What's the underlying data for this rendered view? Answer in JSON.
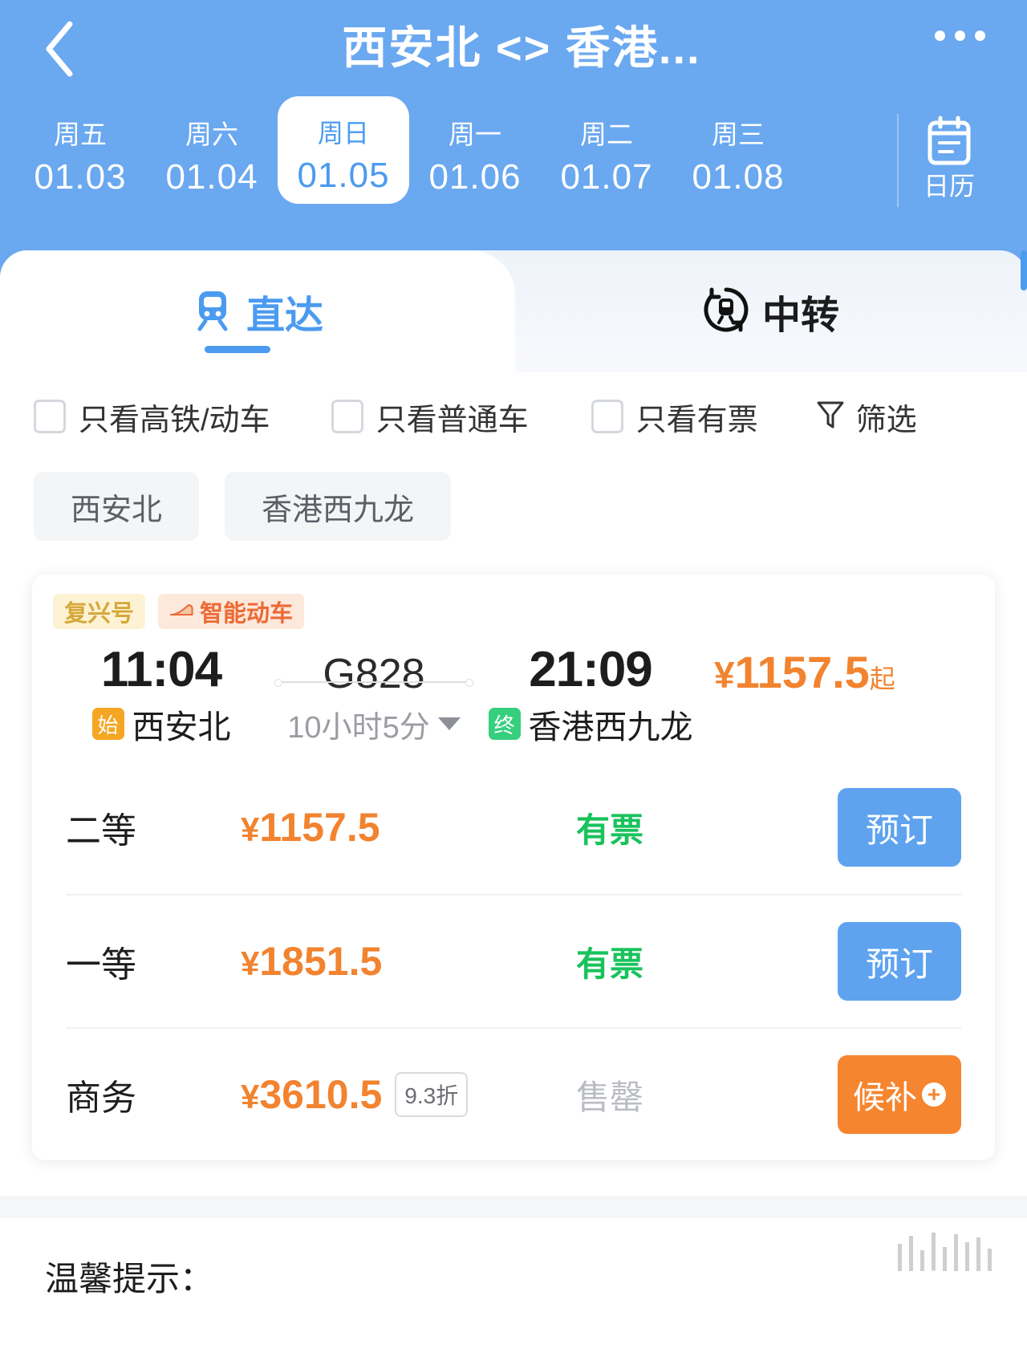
{
  "header": {
    "back_icon": "chevron-left-icon",
    "title": "西安北 <> 香港...",
    "more_icon": "more-options-icon",
    "dates": [
      {
        "dow": "周五",
        "date": "01.03",
        "active": false
      },
      {
        "dow": "周六",
        "date": "01.04",
        "active": false
      },
      {
        "dow": "周日",
        "date": "01.05",
        "active": true
      },
      {
        "dow": "周一",
        "date": "01.06",
        "active": false
      },
      {
        "dow": "周二",
        "date": "01.07",
        "active": false
      },
      {
        "dow": "周三",
        "date": "01.08",
        "active": false
      }
    ],
    "calendar": {
      "icon": "calendar-icon",
      "label": "日历"
    }
  },
  "tabs": {
    "direct": {
      "label": "直达",
      "icon": "train-front-icon",
      "active": true
    },
    "transfer": {
      "label": "中转",
      "icon": "train-transfer-icon",
      "active": false
    }
  },
  "filters": {
    "checkboxes": [
      {
        "label": "只看高铁/动车",
        "checked": false
      },
      {
        "label": "只看普通车",
        "checked": false
      },
      {
        "label": "只看有票",
        "checked": false
      }
    ],
    "filter_button": {
      "label": "筛选",
      "icon": "funnel-icon"
    }
  },
  "station_chips": [
    {
      "label": "西安北"
    },
    {
      "label": "香港西九龙"
    }
  ],
  "train": {
    "badges": [
      {
        "label": "复兴号",
        "icon": null
      },
      {
        "label": "智能动车",
        "icon": "bullet-train-icon"
      }
    ],
    "depart_time": "11:04",
    "train_no": "G828",
    "arrive_time": "21:09",
    "price_from": {
      "currency": "¥",
      "amount": "1157.5",
      "suffix": "起"
    },
    "depart_station": {
      "tag": "始",
      "name": "西安北"
    },
    "arrive_station": {
      "tag": "终",
      "name": "香港西九龙"
    },
    "duration": "10小时5分",
    "duration_caret": "chevron-down-icon",
    "seats": [
      {
        "name": "二等",
        "currency": "¥",
        "price": "1157.5",
        "discount": null,
        "status": "有票",
        "status_kind": "available",
        "action": {
          "label": "预订",
          "kind": "book"
        }
      },
      {
        "name": "一等",
        "currency": "¥",
        "price": "1851.5",
        "discount": null,
        "status": "有票",
        "status_kind": "available",
        "action": {
          "label": "预订",
          "kind": "book"
        }
      },
      {
        "name": "商务",
        "currency": "¥",
        "price": "3610.5",
        "discount": "9.3折",
        "status": "售罄",
        "status_kind": "soldout",
        "action": {
          "label": "候补",
          "kind": "waitlist",
          "plus": "+"
        }
      }
    ]
  },
  "tips": {
    "title": "温馨提示："
  },
  "colors": {
    "brand_blue": "#6aa8f0",
    "accent_blue": "#4b9bf0",
    "price_orange": "#f2832f",
    "available_green": "#19c25c",
    "soldout_gray": "#b9bcc1",
    "waitlist_orange": "#f5852f",
    "start_tag": "#f5a623",
    "end_tag": "#36cf7e"
  }
}
